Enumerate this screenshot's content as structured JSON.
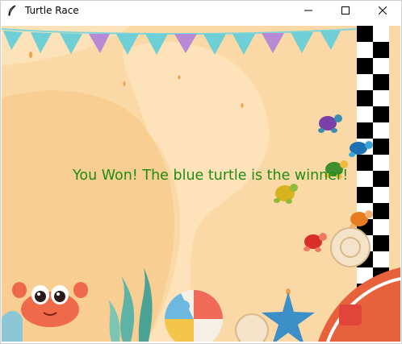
{
  "window": {
    "title": "Turtle Race",
    "app_icon": "feather-icon",
    "controls": [
      "minimize-icon",
      "maximize-icon",
      "close-icon"
    ]
  },
  "game": {
    "message": "You Won! The blue turtle is the winner!",
    "winner": "blue",
    "turtles": [
      {
        "color": "purple"
      },
      {
        "color": "blue"
      },
      {
        "color": "green"
      },
      {
        "color": "yellow"
      },
      {
        "color": "orange"
      },
      {
        "color": "red"
      }
    ],
    "finish_line": "checkered-flag",
    "colors": {
      "background": "#fbd9a6",
      "message": "#1f8c12",
      "bunting": "#6fcfd6"
    }
  }
}
